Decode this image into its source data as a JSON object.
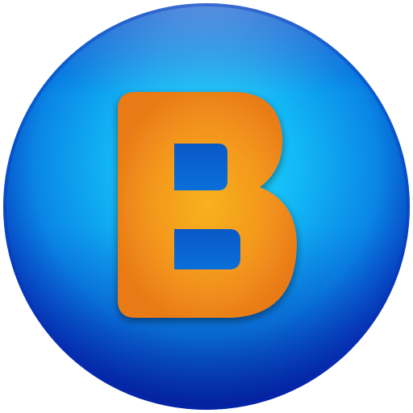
{
  "app_icon": {
    "icon": "letter-b-app-icon",
    "letter": "B",
    "colors": {
      "orb_light": "#25e3ff",
      "orb_mid": "#0a86e6",
      "orb_dark": "#0419a8",
      "orb_rim": "#0a2fb8",
      "letter_light": "#f7b21a",
      "letter_mid": "#f3961f",
      "letter_dark": "#e97a16",
      "letter_hole": "#0a6fd8"
    }
  }
}
